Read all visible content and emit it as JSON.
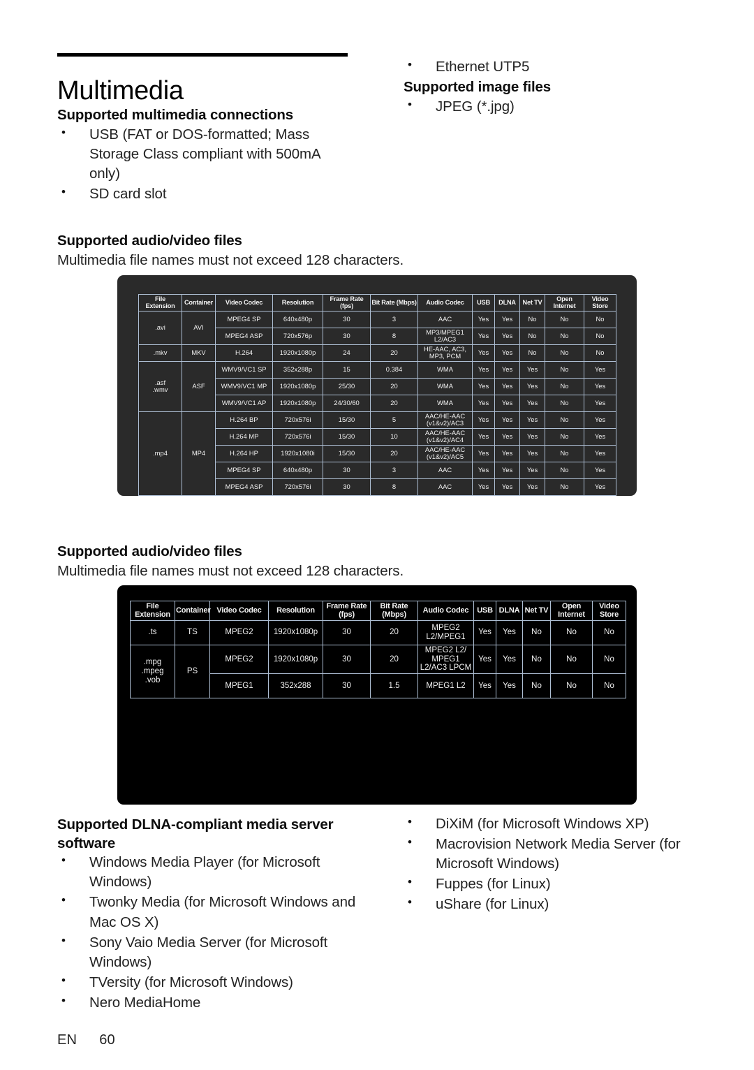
{
  "document": {
    "title": "Multimedia",
    "footer": {
      "language": "EN",
      "page_number": "60"
    }
  },
  "sections": {
    "connections": {
      "heading": "Supported multimedia connections",
      "items": [
        "USB (FAT or DOS-formatted; Mass Storage Class compliant with 500mA only)",
        "SD card slot"
      ]
    },
    "ethernet": {
      "items": [
        "Ethernet UTP5"
      ]
    },
    "image_files": {
      "heading": "Supported image files",
      "items": [
        "JPEG (*.jpg)"
      ]
    },
    "av_files_1": {
      "heading": "Supported audio/video files",
      "note": "Multimedia file names must not exceed 128 characters."
    },
    "av_files_2": {
      "heading": "Supported audio/video files",
      "note": "Multimedia file names must not exceed 128 characters."
    },
    "dlna": {
      "heading_line1": "Supported DLNA-compliant media server",
      "heading_line2": "software",
      "items_left": [
        "Windows Media Player (for Microsoft Windows)",
        "Twonky Media (for Microsoft Windows and Mac OS X)",
        "Sony Vaio Media Server (for Microsoft Windows)",
        "TVersity (for Microsoft Windows)",
        "Nero MediaHome"
      ],
      "items_right": [
        "DiXiM (for Microsoft Windows XP)",
        "Macrovision Network Media Server (for Microsoft Windows)",
        "Fuppes (for Linux)",
        "uShare (for Linux)"
      ]
    }
  },
  "table_1": {
    "headers": [
      "File Extension",
      "Container",
      "Video Codec",
      "Resolution",
      "Frame Rate (fps)",
      "Bit Rate (Mbps)",
      "Audio Codec",
      "USB",
      "DLNA",
      "Net TV",
      "Open Internet",
      "Video Store"
    ],
    "groups": [
      {
        "file_extension": ".avi",
        "container": "AVI",
        "rows": [
          {
            "video_codec": "MPEG4 SP",
            "resolution": "640x480p",
            "frame_rate": "30",
            "bit_rate": "3",
            "audio_codec": "AAC",
            "usb": "Yes",
            "dlna": "Yes",
            "net_tv": "No",
            "open_internet": "No",
            "video_store": "No"
          },
          {
            "video_codec": "MPEG4 ASP",
            "resolution": "720x576p",
            "frame_rate": "30",
            "bit_rate": "8",
            "audio_codec": "MP3/MPEG1 L2/AC3",
            "usb": "Yes",
            "dlna": "Yes",
            "net_tv": "No",
            "open_internet": "No",
            "video_store": "No"
          }
        ]
      },
      {
        "file_extension": ".mkv",
        "container": "MKV",
        "rows": [
          {
            "video_codec": "H.264",
            "resolution": "1920x1080p",
            "frame_rate": "24",
            "bit_rate": "20",
            "audio_codec": "HE-AAC, AC3, MP3, PCM",
            "usb": "Yes",
            "dlna": "Yes",
            "net_tv": "No",
            "open_internet": "No",
            "video_store": "No"
          }
        ]
      },
      {
        "file_extension": ".asf\n.wmv",
        "container": "ASF",
        "rows": [
          {
            "video_codec": "WMV9/VC1 SP",
            "resolution": "352x288p",
            "frame_rate": "15",
            "bit_rate": "0.384",
            "audio_codec": "WMA",
            "usb": "Yes",
            "dlna": "Yes",
            "net_tv": "Yes",
            "open_internet": "No",
            "video_store": "Yes"
          },
          {
            "video_codec": "WMV9/VC1 MP",
            "resolution": "1920x1080p",
            "frame_rate": "25/30",
            "bit_rate": "20",
            "audio_codec": "WMA",
            "usb": "Yes",
            "dlna": "Yes",
            "net_tv": "Yes",
            "open_internet": "No",
            "video_store": "Yes"
          },
          {
            "video_codec": "WMV9/VC1 AP",
            "resolution": "1920x1080p",
            "frame_rate": "24/30/60",
            "bit_rate": "20",
            "audio_codec": "WMA",
            "usb": "Yes",
            "dlna": "Yes",
            "net_tv": "Yes",
            "open_internet": "No",
            "video_store": "Yes"
          }
        ]
      },
      {
        "file_extension": ".mp4",
        "container": "MP4",
        "rows": [
          {
            "video_codec": "H.264 BP",
            "resolution": "720x576i",
            "frame_rate": "15/30",
            "bit_rate": "5",
            "audio_codec": "AAC/HE-AAC (v1&v2)/AC3",
            "usb": "Yes",
            "dlna": "Yes",
            "net_tv": "Yes",
            "open_internet": "No",
            "video_store": "Yes"
          },
          {
            "video_codec": "H.264 MP",
            "resolution": "720x576i",
            "frame_rate": "15/30",
            "bit_rate": "10",
            "audio_codec": "AAC/HE-AAC (v1&v2)/AC4",
            "usb": "Yes",
            "dlna": "Yes",
            "net_tv": "Yes",
            "open_internet": "No",
            "video_store": "Yes"
          },
          {
            "video_codec": "H.264 HP",
            "resolution": "1920x1080i",
            "frame_rate": "15/30",
            "bit_rate": "20",
            "audio_codec": "AAC/HE-AAC (v1&v2)/AC5",
            "usb": "Yes",
            "dlna": "Yes",
            "net_tv": "Yes",
            "open_internet": "No",
            "video_store": "Yes"
          },
          {
            "video_codec": "MPEG4 SP",
            "resolution": "640x480p",
            "frame_rate": "30",
            "bit_rate": "3",
            "audio_codec": "AAC",
            "usb": "Yes",
            "dlna": "Yes",
            "net_tv": "Yes",
            "open_internet": "No",
            "video_store": "Yes"
          },
          {
            "video_codec": "MPEG4 ASP",
            "resolution": "720x576i",
            "frame_rate": "30",
            "bit_rate": "8",
            "audio_codec": "AAC",
            "usb": "Yes",
            "dlna": "Yes",
            "net_tv": "Yes",
            "open_internet": "No",
            "video_store": "Yes"
          }
        ]
      }
    ]
  },
  "table_2": {
    "headers": [
      "File Extension",
      "Container",
      "Video Codec",
      "Resolution",
      "Frame Rate (fps)",
      "Bit Rate (Mbps)",
      "Audio Codec",
      "USB",
      "DLNA",
      "Net TV",
      "Open Internet",
      "Video Store"
    ],
    "groups": [
      {
        "file_extension": ".ts",
        "container": "TS",
        "rows": [
          {
            "video_codec": "MPEG2",
            "resolution": "1920x1080p",
            "frame_rate": "30",
            "bit_rate": "20",
            "audio_codec": "MPEG2 L2/MPEG1",
            "usb": "Yes",
            "dlna": "Yes",
            "net_tv": "No",
            "open_internet": "No",
            "video_store": "No"
          }
        ]
      },
      {
        "file_extension": ".mpg\n.mpeg\n.vob",
        "container": "PS",
        "rows": [
          {
            "video_codec": "MPEG2",
            "resolution": "1920x1080p",
            "frame_rate": "30",
            "bit_rate": "20",
            "audio_codec": "MPEG2 L2/ MPEG1 L2/AC3 LPCM",
            "usb": "Yes",
            "dlna": "Yes",
            "net_tv": "No",
            "open_internet": "No",
            "video_store": "No"
          },
          {
            "video_codec": "MPEG1",
            "resolution": "352x288",
            "frame_rate": "30",
            "bit_rate": "1.5",
            "audio_codec": "MPEG1 L2",
            "usb": "Yes",
            "dlna": "Yes",
            "net_tv": "No",
            "open_internet": "No",
            "video_store": "No"
          }
        ]
      }
    ]
  }
}
